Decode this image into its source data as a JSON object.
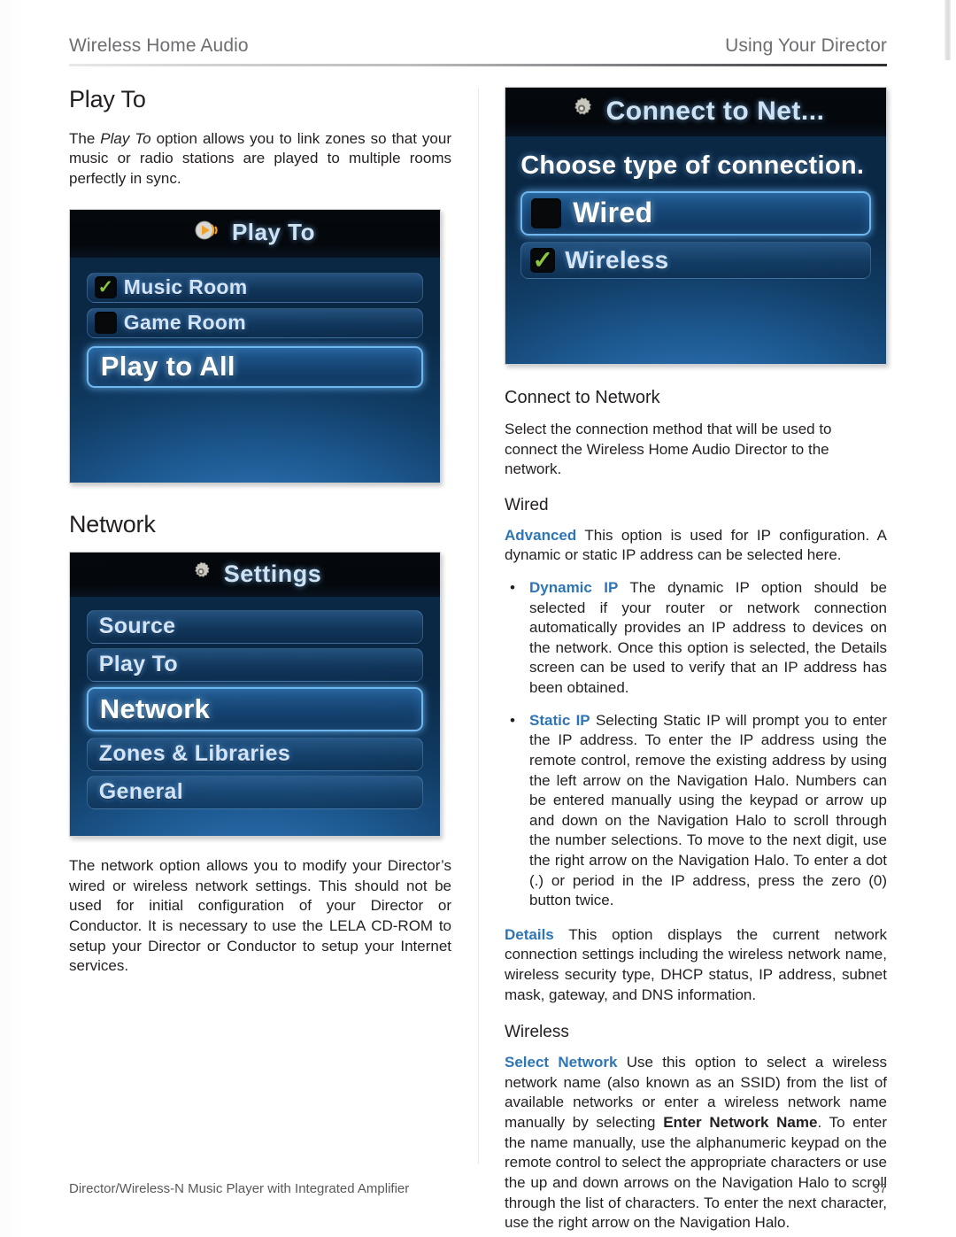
{
  "running_head": {
    "left": "Wireless Home Audio",
    "right": "Using Your Director"
  },
  "left_column": {
    "play_to": {
      "heading": "Play To",
      "intro_before": "The ",
      "intro_italic": "Play To",
      "intro_after": " option allows you to link zones so that your music or radio stations are played to multiple rooms perfectly in sync."
    },
    "play_to_screen": {
      "title": "Play To",
      "title_icon": "play-speaker-icon",
      "rows": [
        {
          "label": "Music Room",
          "checked": true,
          "selected": false
        },
        {
          "label": "Game Room",
          "checked": false,
          "selected": false
        }
      ],
      "action": {
        "label": "Play to All",
        "selected": true
      }
    },
    "network": {
      "heading": "Network",
      "body": "The network option allows you to modify your Director’s wired or wireless network settings. This should not be used for initial configuration of your Director or Conductor. It is necessary to use the LELA CD-ROM to setup your Director or Conductor to setup your Internet services."
    },
    "settings_screen": {
      "title": "Settings",
      "title_icon": "gear-icon",
      "items": [
        {
          "label": "Source",
          "selected": false
        },
        {
          "label": "Play To",
          "selected": false
        },
        {
          "label": "Network",
          "selected": true
        },
        {
          "label": "Zones & Libraries",
          "selected": false
        },
        {
          "label": "General",
          "selected": false
        }
      ]
    }
  },
  "right_column": {
    "connect_screen": {
      "title": "Connect to Net...",
      "title_icon": "gear-icon",
      "prompt": "Choose type of connection.",
      "rows": [
        {
          "label": "Wired",
          "checked": false,
          "selected": true
        },
        {
          "label": "Wireless",
          "checked": true,
          "selected": false
        }
      ]
    },
    "connect_to_network": {
      "heading": "Connect to Network",
      "intro": "Select the connection method that will be used to connect the Wireless Home Audio Director to the network."
    },
    "wired": {
      "heading": "Wired",
      "advanced": {
        "term": "Advanced",
        "text": " This option is used for IP configuration. A dynamic or static IP address can be selected here."
      },
      "bullets": [
        {
          "bullet": "•",
          "term": "Dynamic IP",
          "text": "  The dynamic IP option should be selected if your router or network connection automatically provides an IP address to devices on the network. Once this option is selected, the Details screen can be used to verify that an IP address has been obtained."
        },
        {
          "bullet": "•",
          "term": "Static IP",
          "text": "  Selecting Static IP will prompt you to enter the IP address. To enter the IP address using the remote control, remove the existing address by using the left arrow on the Navigation Halo. Numbers can be entered manually using the keypad or arrow up and down on the Navigation Halo to scroll through the number selections. To move to the next digit, use the right arrow on the Navigation Halo. To enter a dot (.) or period in the IP address, press the zero (0) button twice."
        }
      ],
      "details": {
        "term": "Details",
        "text": " This option displays the current network connection settings including the wireless network name, wireless security type, DHCP status, IP address, subnet mask, gateway, and DNS information."
      }
    },
    "wireless": {
      "heading": "Wireless",
      "select_network": {
        "term": "Select Network",
        "text_1": " Use this option to select a wireless network name (also known as an SSID) from the list of available networks or enter a wireless network name manually by selecting ",
        "bold": "Enter Network Name",
        "text_2": ". To enter the name manually, use the alphanumeric keypad on the remote control to select the appropriate characters or use the up and down arrows on the Navigation Halo to scroll through the list of characters. To enter the next character, use the right arrow on the Navigation Halo."
      }
    }
  },
  "footer": {
    "left": "Director/Wireless-N Music Player with Integrated Amplifier",
    "page_number": "37"
  },
  "colors": {
    "term_blue": "#2e75b6",
    "body_text": "#231f20",
    "running_head": "#6d6e71",
    "screen_blue": "#1e5b94",
    "check_green": "#8cc63e"
  }
}
